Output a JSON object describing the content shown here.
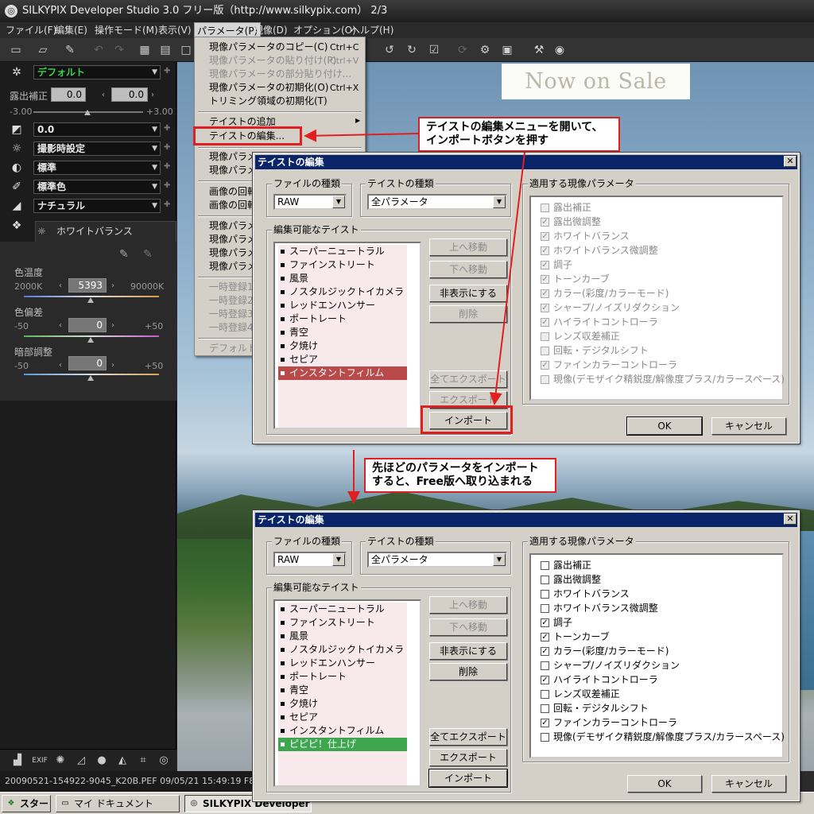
{
  "window": {
    "title": "SILKYPIX Developer Studio 3.0 フリー版（http://www.silkypix.com） 2/3",
    "app_icon": "silkypix-logo-icon"
  },
  "menubar": {
    "items": [
      "ファイル(F)",
      "編集(E)",
      "操作モード(M)",
      "表示(V)",
      "パラメータ(P)",
      "現像(D)",
      "オプション(O)",
      "ヘルプ(H)"
    ],
    "active": "パラメータ(P)"
  },
  "banner": {
    "text": "Now on Sale"
  },
  "left_panel": {
    "taste_select": "デフォルト",
    "exposure_label": "露出補正",
    "exposure_value": "0.0",
    "exposure_value2": "0.0",
    "exposure_min": "-3.00",
    "exposure_max": "+3.00",
    "row2_select": "0.0",
    "wb_select": "撮影時設定",
    "tone_select": "標準",
    "color_select": "標準色",
    "sharp_select": "ナチュラル",
    "wb_tab": "ホワイトバランス",
    "color_temp_label": "色温度",
    "color_temp_min": "2000K",
    "color_temp_value": "5393",
    "color_temp_max": "90000K",
    "tint_label": "色偏差",
    "tint_min": "-50",
    "tint_value": "0",
    "tint_max": "+50",
    "dark_label": "暗部調整",
    "dark_min": "-50",
    "dark_value": "0",
    "dark_max": "+50"
  },
  "status": {
    "text": "20090521-154922-9045_K20B.PEF 09/05/21 15:49:19 F8.0 1/"
  },
  "dropdown": {
    "items": [
      {
        "label": "現像パラメータのコピー(C)",
        "shortcut": "Ctrl+C",
        "disabled": false
      },
      {
        "label": "現像パラメータの貼り付け(P)",
        "shortcut": "Ctrl+V",
        "disabled": true
      },
      {
        "label": "現像パラメータの部分貼り付け...",
        "shortcut": "",
        "disabled": true
      },
      {
        "label": "現像パラメータの初期化(O)",
        "shortcut": "Ctrl+X",
        "disabled": false
      },
      {
        "label": "トリミング領域の初期化(T)",
        "shortcut": "",
        "disabled": false
      },
      {
        "label": "テイストの追加",
        "shortcut": "",
        "disabled": false
      },
      {
        "label": "テイストの編集...",
        "shortcut": "",
        "disabled": false
      },
      {
        "label": "現像パラメ",
        "shortcut": "",
        "disabled": false
      },
      {
        "label": "現像パラメ",
        "shortcut": "",
        "disabled": false
      },
      {
        "label": "画像の回転",
        "shortcut": "",
        "disabled": false
      },
      {
        "label": "画像の回転",
        "shortcut": "",
        "disabled": false
      },
      {
        "label": "現像パラメ",
        "shortcut": "",
        "disabled": false
      },
      {
        "label": "現像パラメ",
        "shortcut": "",
        "disabled": false
      },
      {
        "label": "現像パラメ",
        "shortcut": "",
        "disabled": false
      },
      {
        "label": "現像パラメ",
        "shortcut": "",
        "disabled": false
      },
      {
        "label": "一時登録1",
        "shortcut": "",
        "disabled": true
      },
      {
        "label": "一時登録2",
        "shortcut": "",
        "disabled": true
      },
      {
        "label": "一時登録3",
        "shortcut": "",
        "disabled": true
      },
      {
        "label": "一時登録4",
        "shortcut": "",
        "disabled": true
      },
      {
        "label": "デフォルトパ",
        "shortcut": "",
        "disabled": true
      }
    ]
  },
  "callouts": {
    "top": [
      "テイストの編集メニューを開いて、",
      "インポートボタンを押す"
    ],
    "middle": [
      "先ほどのパラメータをインポート",
      "すると、Free版へ取り込まれる"
    ]
  },
  "dialog1": {
    "title": "テイストの編集",
    "file_type_label": "ファイルの種類",
    "file_type_value": "RAW",
    "taste_type_label": "テイストの種類",
    "taste_type_value": "全パラメータ",
    "editable_label": "編集可能なテイスト",
    "tastes": [
      "スーパーニュートラル",
      "ファインストリート",
      "風景",
      "ノスタルジックトイカメラ",
      "レッドエンハンサー",
      "ポートレート",
      "青空",
      "夕焼け",
      "セピア",
      "インスタントフィルム"
    ],
    "selected_taste": "インスタントフィルム",
    "buttons": {
      "up": "上へ移動",
      "down": "下へ移動",
      "hide": "非表示にする",
      "delete": "削除",
      "export_all": "全てエクスポート",
      "export": "エクスポート",
      "import": "インポート",
      "ok": "OK",
      "cancel": "キャンセル"
    },
    "params_label": "適用する現像パラメータ",
    "params": [
      {
        "label": "露出補正",
        "checked": false,
        "disabled": true
      },
      {
        "label": "露出微調整",
        "checked": true,
        "disabled": true
      },
      {
        "label": "ホワイトバランス",
        "checked": true,
        "disabled": true
      },
      {
        "label": "ホワイトバランス微調整",
        "checked": true,
        "disabled": true
      },
      {
        "label": "調子",
        "checked": true,
        "disabled": true
      },
      {
        "label": "トーンカーブ",
        "checked": true,
        "disabled": true
      },
      {
        "label": "カラー(彩度/カラーモード)",
        "checked": true,
        "disabled": true
      },
      {
        "label": "シャープ/ノイズリダクション",
        "checked": true,
        "disabled": true
      },
      {
        "label": "ハイライトコントローラ",
        "checked": true,
        "disabled": true
      },
      {
        "label": "レンズ収差補正",
        "checked": false,
        "disabled": true
      },
      {
        "label": "回転・デジタルシフト",
        "checked": false,
        "disabled": true
      },
      {
        "label": "ファインカラーコントローラ",
        "checked": true,
        "disabled": true
      },
      {
        "label": "現像(デモザイク精鋭度/解像度プラス/カラースペース)",
        "checked": false,
        "disabled": true
      }
    ]
  },
  "dialog2": {
    "title": "テイストの編集",
    "file_type_label": "ファイルの種類",
    "file_type_value": "RAW",
    "taste_type_label": "テイストの種類",
    "taste_type_value": "全パラメータ",
    "editable_label": "編集可能なテイスト",
    "tastes": [
      "スーパーニュートラル",
      "ファインストリート",
      "風景",
      "ノスタルジックトイカメラ",
      "レッドエンハンサー",
      "ポートレート",
      "青空",
      "夕焼け",
      "セピア",
      "インスタントフィルム",
      "ピピピ！仕上げ"
    ],
    "selected_taste": "ピピピ！仕上げ",
    "buttons": {
      "up": "上へ移動",
      "down": "下へ移動",
      "hide": "非表示にする",
      "delete": "削除",
      "export_all": "全てエクスポート",
      "export": "エクスポート",
      "import": "インポート",
      "ok": "OK",
      "cancel": "キャンセル"
    },
    "params_label": "適用する現像パラメータ",
    "params": [
      {
        "label": "露出補正",
        "checked": false,
        "disabled": false
      },
      {
        "label": "露出微調整",
        "checked": false,
        "disabled": false
      },
      {
        "label": "ホワイトバランス",
        "checked": false,
        "disabled": false
      },
      {
        "label": "ホワイトバランス微調整",
        "checked": false,
        "disabled": false
      },
      {
        "label": "調子",
        "checked": true,
        "disabled": false
      },
      {
        "label": "トーンカーブ",
        "checked": true,
        "disabled": false
      },
      {
        "label": "カラー(彩度/カラーモード)",
        "checked": true,
        "disabled": false
      },
      {
        "label": "シャープ/ノイズリダクション",
        "checked": false,
        "disabled": false
      },
      {
        "label": "ハイライトコントローラ",
        "checked": true,
        "disabled": false
      },
      {
        "label": "レンズ収差補正",
        "checked": false,
        "disabled": false
      },
      {
        "label": "回転・デジタルシフト",
        "checked": false,
        "disabled": false
      },
      {
        "label": "ファインカラーコントローラ",
        "checked": true,
        "disabled": false
      },
      {
        "label": "現像(デモザイク精鋭度/解像度プラス/カラースペース)",
        "checked": false,
        "disabled": false
      }
    ]
  },
  "taskbar": {
    "start": "スタート",
    "tasks": [
      "マイ ドキュメント",
      "SILKYPIX Developer S..."
    ]
  },
  "colors": {
    "annotation_red": "#e02020",
    "dialog_title_bg": "#0a246a",
    "taste_selected_red": "#b94a4a",
    "taste_selected_green": "#3fa650",
    "preset_green": "#39d14a"
  }
}
